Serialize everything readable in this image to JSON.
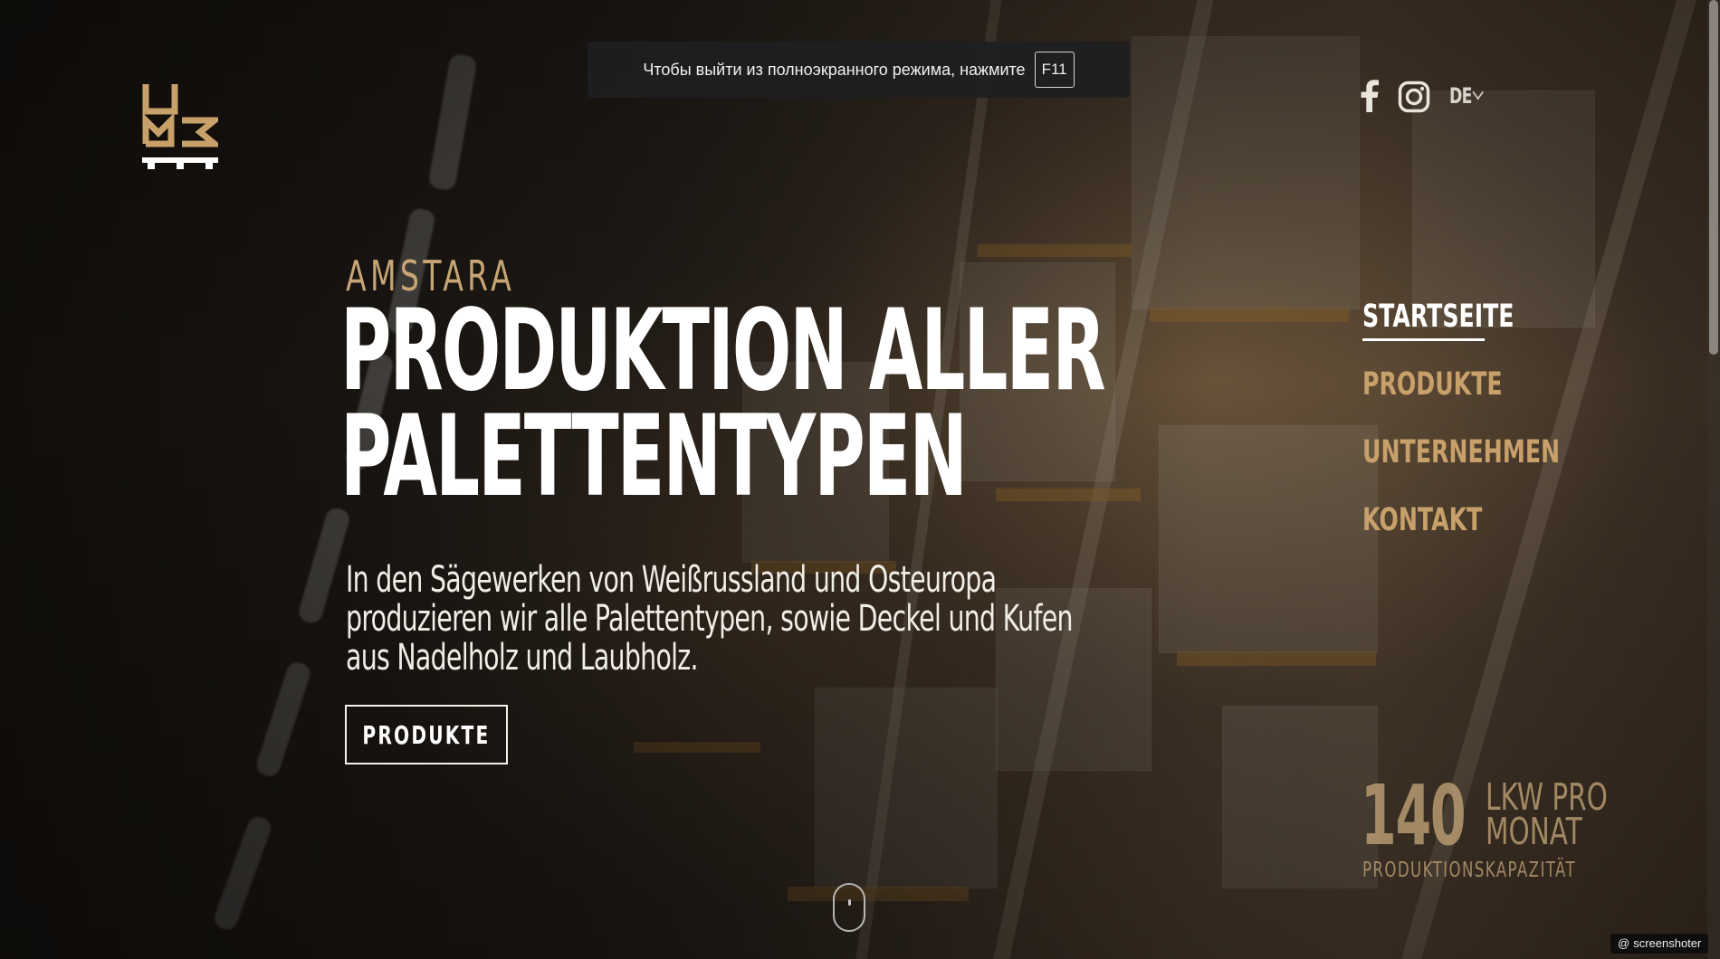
{
  "fullscreen_notice": {
    "text": "Чтобы выйти из полноэкранного режима, нажмите",
    "key": "F11"
  },
  "header": {
    "language": "DE",
    "social": [
      "facebook-icon",
      "instagram-icon"
    ]
  },
  "hero": {
    "eyebrow": "AMSTARA",
    "headline_line1": "PRODUKTION ALLER",
    "headline_line2": "PALETTENTYPEN",
    "lead": "In den Sägewerken von Weißrussland und Osteuropa produzieren wir alle Palettentypen, sowie Deckel und Kufen aus Nadelholz und Laubholz.",
    "cta_label": "PRODUKTE"
  },
  "nav": {
    "items": [
      {
        "label": "STARTSEITE",
        "active": true
      },
      {
        "label": "PRODUKTE",
        "active": false
      },
      {
        "label": "UNTERNEHMEN",
        "active": false
      },
      {
        "label": "KONTAKT",
        "active": false
      }
    ]
  },
  "stat": {
    "number": "140",
    "unit": "LKW PRO MONAT",
    "caption": "PRODUKTIONSKAPAZITÄT"
  },
  "watermark": {
    "text": "screenshoter"
  },
  "colors": {
    "accent": "#c8a06a",
    "text": "#ffffff"
  }
}
